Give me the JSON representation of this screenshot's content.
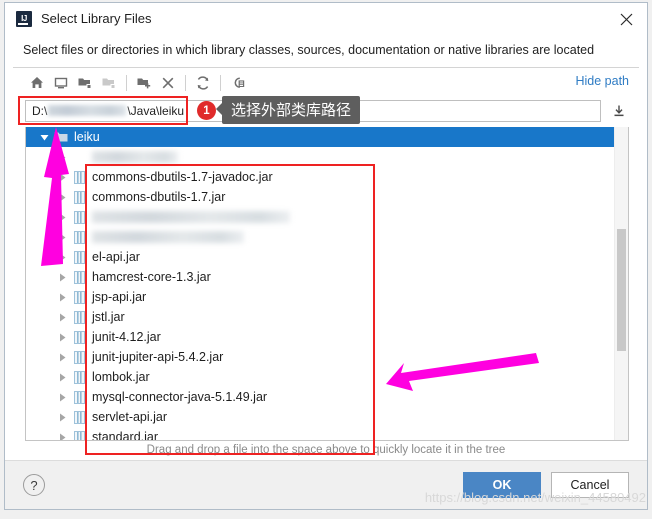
{
  "window": {
    "title": "Select Library Files",
    "app_icon": "intellij-idea-icon",
    "close_icon": "close-icon",
    "subtitle": "Select files or directories in which library classes, sources, documentation or native libraries are located"
  },
  "toolbar": {
    "buttons": [
      {
        "name": "home-icon",
        "tooltip": "Home",
        "enabled": true
      },
      {
        "name": "desktop-icon",
        "tooltip": "Desktop",
        "enabled": true
      },
      {
        "name": "folder-up-icon",
        "tooltip": "Up",
        "enabled": true
      },
      {
        "name": "folder-icon",
        "tooltip": "Folder",
        "enabled": false
      },
      {
        "name": "new-folder-icon",
        "tooltip": "New Folder",
        "enabled": true
      },
      {
        "name": "delete-icon",
        "tooltip": "Delete",
        "enabled": true
      },
      {
        "name": "refresh-icon",
        "tooltip": "Refresh",
        "enabled": true
      },
      {
        "name": "show-hidden-files-icon",
        "tooltip": "Show Hidden Files",
        "enabled": true
      }
    ],
    "hide_path_label": "Hide path"
  },
  "path_field": {
    "prefix": "D:\\",
    "blurred": true,
    "suffix": "\\Java\\leiku",
    "full_value": "D:\\\\Java\\leiku",
    "download_icon": "download-icon"
  },
  "annotations": {
    "badge_1": "1",
    "tooltip_1": "选择外部类库路径",
    "arrow_left": "magenta-arrow-up",
    "arrow_right": "magenta-arrow-left",
    "redbox_path": "red-highlight-path-field",
    "redbox_files": "red-highlight-file-list"
  },
  "tree": {
    "rows": [
      {
        "id": "leiku",
        "label": "leiku",
        "icon": "folder-icon",
        "indent": 1,
        "selected": true,
        "expanded": true,
        "blurred": false
      },
      {
        "id": "blur1",
        "label": "",
        "icon": "none",
        "indent": 2,
        "selected": false,
        "expanded": false,
        "blurred": true,
        "blur_width": 86
      },
      {
        "id": "jar1",
        "label": "commons-dbutils-1.7-javadoc.jar",
        "icon": "jar-icon",
        "indent": 2,
        "selected": false,
        "expanded": false,
        "blurred": false
      },
      {
        "id": "jar2",
        "label": "commons-dbutils-1.7.jar",
        "icon": "jar-icon",
        "indent": 2,
        "selected": false,
        "expanded": false,
        "blurred": false
      },
      {
        "id": "blur2",
        "label": "",
        "icon": "jar-icon",
        "indent": 2,
        "selected": false,
        "expanded": false,
        "blurred": true,
        "blur_width": 198
      },
      {
        "id": "blur3",
        "label": "",
        "icon": "jar-icon",
        "indent": 2,
        "selected": false,
        "expanded": false,
        "blurred": true,
        "blur_width": 152
      },
      {
        "id": "jar3",
        "label": "el-api.jar",
        "icon": "jar-icon",
        "indent": 2,
        "selected": false,
        "expanded": false,
        "blurred": false
      },
      {
        "id": "jar4",
        "label": "hamcrest-core-1.3.jar",
        "icon": "jar-icon",
        "indent": 2,
        "selected": false,
        "expanded": false,
        "blurred": false
      },
      {
        "id": "jar5",
        "label": "jsp-api.jar",
        "icon": "jar-icon",
        "indent": 2,
        "selected": false,
        "expanded": false,
        "blurred": false
      },
      {
        "id": "jar6",
        "label": "jstl.jar",
        "icon": "jar-icon",
        "indent": 2,
        "selected": false,
        "expanded": false,
        "blurred": false
      },
      {
        "id": "jar7",
        "label": "junit-4.12.jar",
        "icon": "jar-icon",
        "indent": 2,
        "selected": false,
        "expanded": false,
        "blurred": false
      },
      {
        "id": "jar8",
        "label": "junit-jupiter-api-5.4.2.jar",
        "icon": "jar-icon",
        "indent": 2,
        "selected": false,
        "expanded": false,
        "blurred": false
      },
      {
        "id": "jar9",
        "label": "lombok.jar",
        "icon": "jar-icon",
        "indent": 2,
        "selected": false,
        "expanded": false,
        "blurred": false
      },
      {
        "id": "jar10",
        "label": "mysql-connector-java-5.1.49.jar",
        "icon": "jar-icon",
        "indent": 2,
        "selected": false,
        "expanded": false,
        "blurred": false
      },
      {
        "id": "jar11",
        "label": "servlet-api.jar",
        "icon": "jar-icon",
        "indent": 2,
        "selected": false,
        "expanded": false,
        "blurred": false
      },
      {
        "id": "jar12",
        "label": "standard.jar",
        "icon": "jar-icon",
        "indent": 2,
        "selected": false,
        "expanded": false,
        "blurred": false
      }
    ],
    "scrollbar": {
      "thumb_top_pct": 30,
      "thumb_height_pct": 36
    }
  },
  "hint": "Drag and drop a file into the space above to quickly locate it in the tree",
  "footer": {
    "help_label": "?",
    "ok_label": "OK",
    "cancel_label": "Cancel"
  },
  "watermark": "https://blog.csdn.net/weixin_44580492",
  "colors": {
    "selection_blue": "#1877c9",
    "link_blue": "#2f7cc4",
    "primary_button": "#4a86c5",
    "annotation_red": "#ee2222",
    "annotation_magenta": "#ff00e0",
    "tooltip_bg": "#5e5e5e"
  }
}
